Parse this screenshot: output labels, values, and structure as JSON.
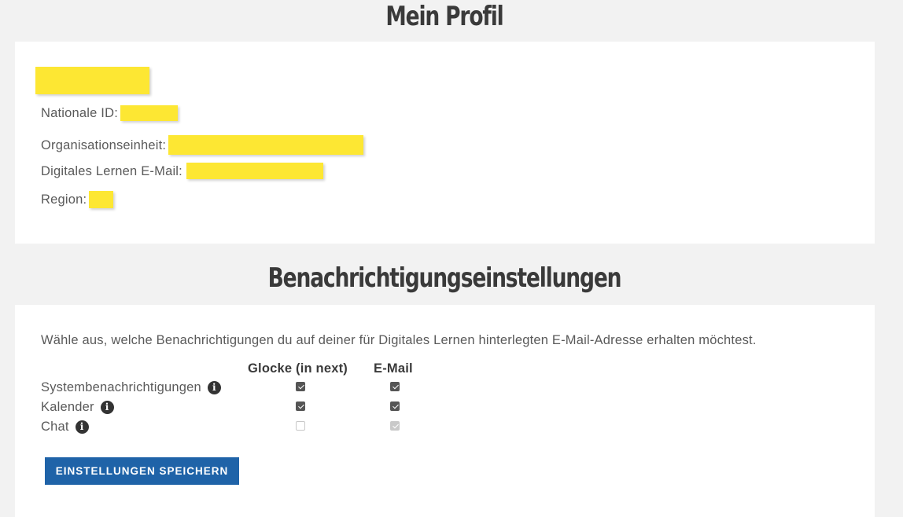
{
  "profile": {
    "heading": "Mein Profil",
    "fields": [
      {
        "label": "Nationale ID:"
      },
      {
        "label": "Organisationseinheit:"
      },
      {
        "label": "Digitales Lernen E-Mail:"
      },
      {
        "label": "Region:"
      }
    ]
  },
  "notifications": {
    "heading": "Benachrichtigungseinstellungen",
    "intro": "Wähle aus, welche Benachrichtigungen du auf deiner für Digitales Lernen hinterlegten E-Mail-Adresse erhalten möchtest.",
    "columns": [
      "Glocke (in next)",
      "E-Mail"
    ],
    "rows": [
      {
        "label": "Systembenachrichtigungen",
        "bell": true,
        "email": true,
        "bell_disabled": false,
        "email_disabled": false
      },
      {
        "label": "Kalender",
        "bell": true,
        "email": true,
        "bell_disabled": false,
        "email_disabled": false
      },
      {
        "label": "Chat",
        "bell": false,
        "email": true,
        "bell_disabled": true,
        "email_disabled": true
      }
    ],
    "info_icon_glyph": "i",
    "save_label": "EINSTELLUNGEN SPEICHERN"
  },
  "colors": {
    "background": "#f2f2f2",
    "card": "#ffffff",
    "redaction": "#fde733",
    "button": "#1f63a8"
  }
}
